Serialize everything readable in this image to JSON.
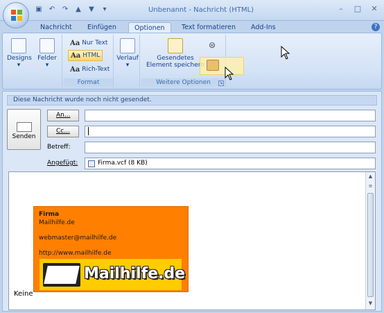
{
  "window": {
    "title": "Unbenannt - Nachricht (HTML)"
  },
  "tabs": [
    {
      "label": "Nachricht"
    },
    {
      "label": "Einfügen"
    },
    {
      "label": "Optionen"
    },
    {
      "label": "Text formatieren"
    },
    {
      "label": "Add-Ins"
    }
  ],
  "ribbon": {
    "designs": "Designs",
    "felder": "Felder",
    "format": {
      "nur_text": "Nur Text",
      "html": "HTML",
      "rich_text": "Rich-Text",
      "group_label": "Format"
    },
    "verlauf": "Verlauf",
    "weitere": {
      "gesendetes_line1": "Gesendetes",
      "gesendetes_line2": "Element speichern",
      "group_label": "Weitere Optionen"
    }
  },
  "info": {
    "text": "Diese Nachricht wurde noch nicht gesendet."
  },
  "compose": {
    "send_label": "Senden",
    "an_label": "An...",
    "cc_label": "Cc...",
    "betreff_label": "Betreff:",
    "angefuegt_label": "Angefügt:",
    "an_value": "",
    "cc_value": "",
    "betreff_value": "",
    "attachment": "Firma.vcf (8 KB)"
  },
  "card": {
    "name": "Firma",
    "company": "Mailhilfe.de",
    "email": "webmaster@mailhilfe.de",
    "url": "http://www.mailhilfe.de",
    "banner_text": "Mailhilfe.de"
  },
  "body": {
    "text": "Keine"
  }
}
